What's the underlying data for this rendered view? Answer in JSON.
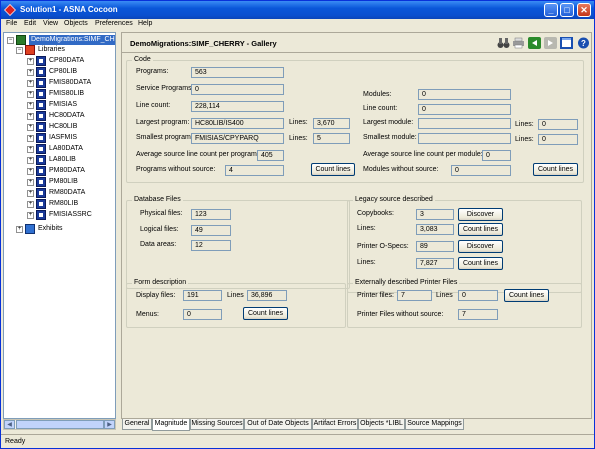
{
  "window": {
    "title": "Solution1 - ASNA Cocoon",
    "minimize": "_",
    "maximize": "□",
    "close": "✕"
  },
  "menu": [
    "File",
    "Edit",
    "View",
    "Objects",
    "Preferences",
    "Help"
  ],
  "tree": {
    "root": "DemoMigrations:SIMF_CHERRY",
    "libraries_label": "Libraries",
    "libraries": [
      "CP80DATA",
      "CP80LIB",
      "FMIS80DATA",
      "FMIS80LIB",
      "FMISIAS",
      "HC80DATA",
      "HC80LIB",
      "IASFMIS",
      "LA80DATA",
      "LA80LIB",
      "PM80DATA",
      "PM80LIB",
      "RM80DATA",
      "RM80LIB",
      "FMISIASSRC"
    ],
    "exhibits_label": "Exhibits"
  },
  "main": {
    "title": "DemoMigrations:SIMF_CHERRY - Gallery",
    "toolbar_icons": [
      "binoculars-icon",
      "print-icon",
      "back-icon",
      "forward-icon",
      "window-icon",
      "help-icon"
    ]
  },
  "code": {
    "label": "Code",
    "programs_label": "Programs:",
    "programs": "563",
    "service_programs_label": "Service Programs:",
    "service_programs": "0",
    "line_count_label": "Line count:",
    "line_count": "228,114",
    "largest_program_label": "Largest program:",
    "largest_program": "HC80LIB/IS400",
    "largest_lines_label": "Lines:",
    "largest_lines": "3,670",
    "smallest_program_label": "Smallest program:",
    "smallest_program": "FMISIAS/CPYPARQ",
    "smallest_lines_label": "Lines:",
    "smallest_lines": "5",
    "avg_program_label": "Average source line count per program:",
    "avg_program": "405",
    "without_source_label": "Programs without source:",
    "without_source": "4",
    "count_lines_button": "Count lines",
    "modules_label": "Modules:",
    "modules": "0",
    "mod_line_count_label": "Line count:",
    "mod_line_count": "0",
    "largest_module_label": "Largest module:",
    "largest_module": "",
    "largest_mod_lines_label": "Lines:",
    "largest_mod_lines": "0",
    "smallest_module_label": "Smallest module:",
    "smallest_module": "",
    "smallest_mod_lines_label": "Lines:",
    "smallest_mod_lines": "0",
    "avg_module_label": "Average source line count per module:",
    "avg_module": "0",
    "modules_without_source_label": "Modules without source:",
    "modules_without_source": "0",
    "mod_count_lines_button": "Count lines"
  },
  "database": {
    "label": "Database Files",
    "physical_label": "Physical files:",
    "physical": "123",
    "logical_label": "Logical files:",
    "logical": "49",
    "data_areas_label": "Data areas:",
    "data_areas": "12"
  },
  "legacy": {
    "label": "Legacy source described",
    "copybooks_label": "Copybooks:",
    "copybooks": "3",
    "discover_button": "Discover",
    "lines1_label": "Lines:",
    "lines1": "3,083",
    "count_lines_button1": "Count lines",
    "printer_ospecs_label": "Printer O-Specs:",
    "printer_ospecs": "89",
    "discover_button2": "Discover",
    "lines2_label": "Lines:",
    "lines2": "7,827",
    "count_lines_button2": "Count lines"
  },
  "form": {
    "label": "Form description",
    "display_files_label": "Display files:",
    "display_files": "191",
    "lines_label": "Lines",
    "lines": "36,896",
    "menus_label": "Menus:",
    "menus": "0",
    "count_lines_button": "Count lines"
  },
  "printer": {
    "label": "Externally described Printer Files",
    "printer_files_label": "Printer files:",
    "printer_files": "7",
    "lines_label": "Lines",
    "lines": "0",
    "count_lines_button": "Count lines",
    "without_source_label": "Printer Files without source:",
    "without_source": "7"
  },
  "tabs": [
    "General",
    "Magnitude",
    "Missing Sources",
    "Out of Date Objects",
    "Artifact Errors",
    "Objects *LIBL",
    "Source Mappings"
  ],
  "active_tab": "Magnitude",
  "status": "Ready"
}
